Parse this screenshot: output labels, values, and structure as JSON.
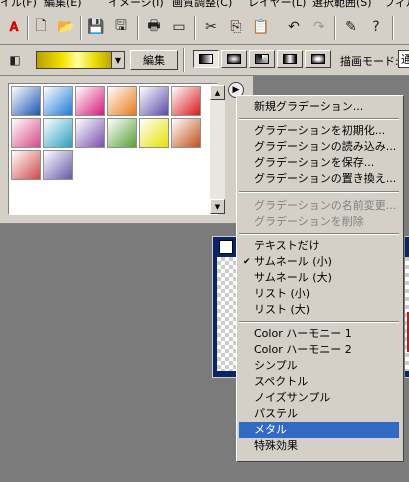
{
  "menubar": {
    "items": [
      "イル(F)",
      "編集(E)",
      "イメージ(I)",
      "画質調整(C)",
      "レイヤー(L)",
      "選択範囲(S)",
      "フィル"
    ]
  },
  "toolbar": {
    "icons": [
      "adobe-logo",
      "new-doc",
      "open-folder",
      "save-disk",
      "print",
      "cut",
      "copy",
      "paste",
      "undo",
      "redo",
      "pencil",
      "help"
    ]
  },
  "options_bar": {
    "edit_button": "編集",
    "mode_label": "描画モード:",
    "mode_value": "通常"
  },
  "gradient_swatches": [
    [
      "#ffffff",
      "#1a56b0"
    ],
    [
      "#ffffff",
      "#1a7bd8"
    ],
    [
      "#ffffff",
      "#d8187a"
    ],
    [
      "#ffffff",
      "#e87a18"
    ],
    [
      "#ffffff",
      "#5a4aa8"
    ],
    [
      "#ffffff",
      "#d81818"
    ],
    [
      "#ffffff",
      "#d84888"
    ],
    [
      "#ffffff",
      "#28a0c0"
    ],
    [
      "#ffffff",
      "#7a50b0"
    ],
    [
      "#ffffff",
      "#58a038"
    ],
    [
      "#ffffff",
      "#e8e000"
    ],
    [
      "#ffffff",
      "#c05018"
    ],
    [
      "#ffffff",
      "#d04848"
    ],
    [
      "#ffffff",
      "#6858a8"
    ]
  ],
  "popup_menu": {
    "group1": [
      "新規グラデーション..."
    ],
    "group2": [
      "グラデーションを初期化...",
      "グラデーションの読み込み...",
      "グラデーションを保存...",
      "グラデーションの置き換え..."
    ],
    "group3": [
      "グラデーションの名前変更...",
      "グラデーションを削除"
    ],
    "group4": [
      "テキストだけ",
      "サムネール (小)",
      "サムネール (大)",
      "リスト (小)",
      "リスト (大)"
    ],
    "group5": [
      "Color ハーモニー 1",
      "Color ハーモニー 2",
      "シンプル",
      "スペクトル",
      "ノイズサンプル",
      "パステル",
      "メタル",
      "特殊効果"
    ],
    "checked_item": "サムネール (小)",
    "highlighted_item": "メタル",
    "checkmark": "✔"
  }
}
